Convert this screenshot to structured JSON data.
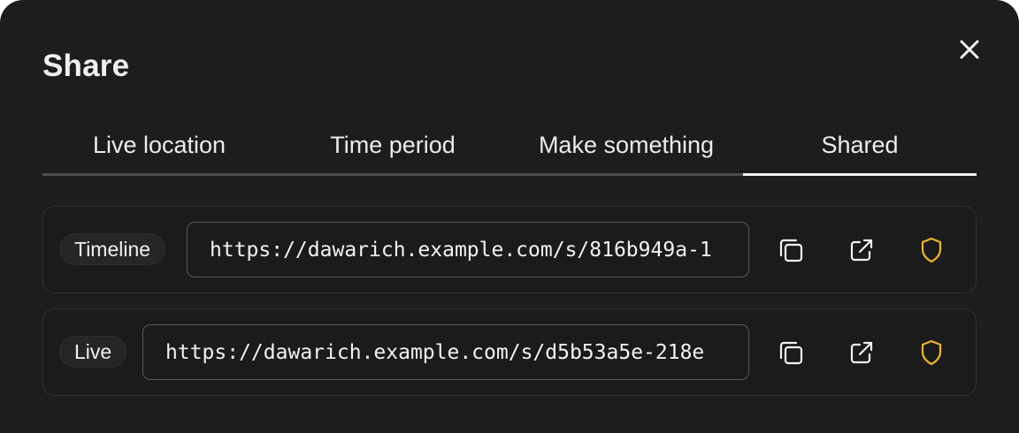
{
  "dialog": {
    "title": "Share"
  },
  "tabs": [
    {
      "label": "Live location",
      "active": false
    },
    {
      "label": "Time period",
      "active": false
    },
    {
      "label": "Make something",
      "active": false
    },
    {
      "label": "Shared",
      "active": true
    }
  ],
  "shares": [
    {
      "type_label": "Timeline",
      "url": "https://dawarich.example.com/s/816b949a-1",
      "icons": [
        "copy-icon",
        "external-link-icon",
        "shield-icon"
      ]
    },
    {
      "type_label": "Live",
      "url": "https://dawarich.example.com/s/d5b53a5e-218e",
      "icons": [
        "copy-icon",
        "external-link-icon",
        "shield-icon"
      ]
    }
  ],
  "colors": {
    "background": "#1d1d1d",
    "text": "#f2f2f2",
    "shield": "#f2b624",
    "tab_active_underline": "#f4f4f4",
    "tab_track": "#4c4c4c"
  }
}
